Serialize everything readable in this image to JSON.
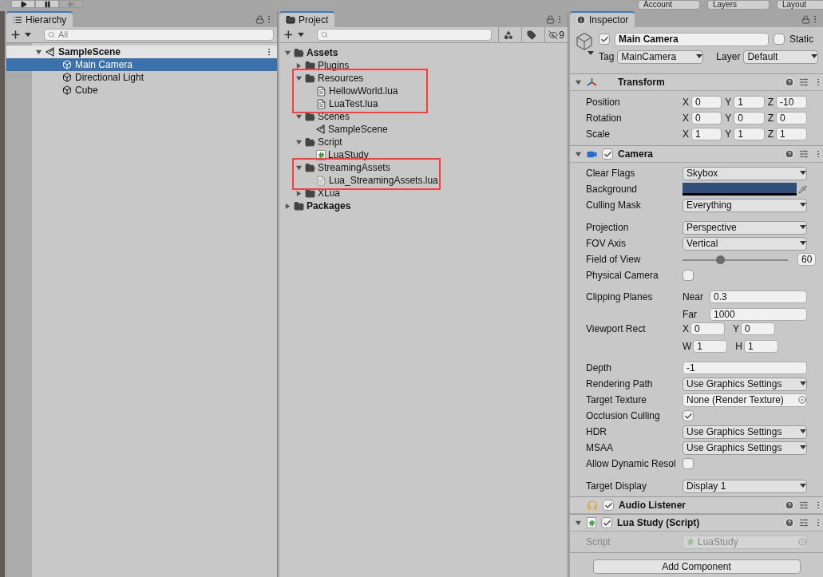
{
  "toolbar": {
    "play_buttons": [
      {
        "kind": "play",
        "disabled": false
      },
      {
        "kind": "pause",
        "disabled": false
      },
      {
        "kind": "step",
        "disabled": true
      }
    ],
    "dropdowns": [
      "Account",
      "Layers",
      "Layout"
    ]
  },
  "hierarchy": {
    "title": "Hierarchy",
    "search": {
      "placeholder": "All"
    },
    "scene": {
      "name": "SampleScene",
      "expanded": true
    },
    "objects": [
      {
        "name": "Main Camera",
        "selected": true
      },
      {
        "name": "Directional Light",
        "selected": false
      },
      {
        "name": "Cube",
        "selected": false
      }
    ]
  },
  "project": {
    "title": "Project",
    "hidden_count": "9",
    "tree": [
      {
        "name": "Assets",
        "kind": "folder",
        "bold": true,
        "expanded": true,
        "highlighted": false,
        "children": [
          {
            "name": "Plugins",
            "kind": "folder",
            "bold": false,
            "expanded": false,
            "highlighted": false
          },
          {
            "name": "Resources",
            "kind": "folder",
            "bold": false,
            "expanded": true,
            "highlighted": true,
            "children": [
              {
                "name": "HellowWorld.lua",
                "kind": "text",
                "bold": false,
                "highlighted": false
              },
              {
                "name": "LuaTest.lua",
                "kind": "text",
                "bold": false,
                "highlighted": false
              }
            ]
          },
          {
            "name": "Scenes",
            "kind": "folder",
            "bold": false,
            "expanded": true,
            "highlighted": false,
            "children": [
              {
                "name": "SampleScene",
                "kind": "scene",
                "bold": false,
                "highlighted": false
              }
            ]
          },
          {
            "name": "Script",
            "kind": "folder",
            "bold": false,
            "expanded": true,
            "highlighted": false,
            "children": [
              {
                "name": "LuaStudy",
                "kind": "script",
                "bold": false,
                "highlighted": false
              }
            ]
          },
          {
            "name": "StreamingAssets",
            "kind": "folder",
            "bold": false,
            "expanded": true,
            "highlighted": true,
            "children": [
              {
                "name": "Lua_StreamingAssets.lua",
                "kind": "lined",
                "bold": false,
                "highlighted": false
              }
            ]
          },
          {
            "name": "XLua",
            "kind": "folder",
            "bold": false,
            "expanded": false,
            "highlighted": false
          }
        ]
      },
      {
        "name": "Packages",
        "kind": "folder",
        "bold": true,
        "expanded": false,
        "highlighted": false
      }
    ]
  },
  "inspector": {
    "title": "Inspector",
    "object": {
      "active": true,
      "name": "Main Camera",
      "static_label": "Static",
      "static": false,
      "tag_label": "Tag",
      "tag": "MainCamera",
      "layer_label": "Layer",
      "layer": "Default"
    },
    "components": [
      {
        "kind": "transform",
        "title": "Transform",
        "expanded": true,
        "rows": [
          {
            "label": "Position",
            "values": [
              {
                "axis": "X",
                "value": "0"
              },
              {
                "axis": "Y",
                "value": "1"
              },
              {
                "axis": "Z",
                "value": "-10"
              }
            ]
          },
          {
            "label": "Rotation",
            "values": [
              {
                "axis": "X",
                "value": "0"
              },
              {
                "axis": "Y",
                "value": "0"
              },
              {
                "axis": "Z",
                "value": "0"
              }
            ]
          },
          {
            "label": "Scale",
            "values": [
              {
                "axis": "X",
                "value": "1"
              },
              {
                "axis": "Y",
                "value": "1"
              },
              {
                "axis": "Z",
                "value": "1"
              }
            ]
          }
        ]
      },
      {
        "kind": "camera",
        "title": "Camera",
        "expanded": true,
        "enabled": true,
        "groups": [
          [
            {
              "kind": "dropdown",
              "label": "Clear Flags",
              "value": "Skybox"
            },
            {
              "kind": "color",
              "label": "Background",
              "color": "#314d79"
            },
            {
              "kind": "dropdown",
              "label": "Culling Mask",
              "value": "Everything"
            }
          ],
          [
            {
              "kind": "dropdown",
              "label": "Projection",
              "value": "Perspective"
            },
            {
              "kind": "dropdown",
              "label": "FOV Axis",
              "value": "Vertical"
            },
            {
              "kind": "slider",
              "label": "Field of View",
              "level": 0.35,
              "value": "60"
            },
            {
              "kind": "checkbox",
              "label": "Physical Camera",
              "checked": false
            }
          ],
          [
            {
              "kind": "pairs",
              "label": "Clipping Planes",
              "fields": [
                [
                  {
                    "axis": "Near",
                    "value": "0.3"
                  }
                ],
                [
                  {
                    "axis": "Far",
                    "value": "1000"
                  }
                ]
              ]
            },
            {
              "kind": "rect",
              "label": "Viewport Rect",
              "fields": [
                [
                  {
                    "axis": "X",
                    "value": "0"
                  },
                  {
                    "axis": "Y",
                    "value": "0"
                  }
                ],
                [
                  {
                    "axis": "W",
                    "value": "1"
                  },
                  {
                    "axis": "H",
                    "value": "1"
                  }
                ]
              ]
            }
          ],
          [
            {
              "kind": "text",
              "label": "Depth",
              "value": "-1"
            },
            {
              "kind": "dropdown",
              "label": "Rendering Path",
              "value": "Use Graphics Settings"
            },
            {
              "kind": "object",
              "label": "Target Texture",
              "value": "None (Render Texture)"
            },
            {
              "kind": "checkbox",
              "label": "Occlusion Culling",
              "checked": true
            },
            {
              "kind": "dropdown",
              "label": "HDR",
              "value": "Use Graphics Settings"
            },
            {
              "kind": "dropdown",
              "label": "MSAA",
              "value": "Use Graphics Settings"
            },
            {
              "kind": "checkbox",
              "label": "Allow Dynamic Resol",
              "checked": false
            }
          ],
          [
            {
              "kind": "dropdown",
              "label": "Target Display",
              "value": "Display 1"
            }
          ]
        ]
      },
      {
        "kind": "audio",
        "title": "Audio Listener",
        "enabled": true
      },
      {
        "kind": "script",
        "title": "Lua Study (Script)",
        "expanded": true,
        "enabled": true,
        "groups": [
          [
            {
              "kind": "script_ref",
              "label": "Script",
              "value": "LuaStudy",
              "disabled": true
            }
          ]
        ]
      }
    ],
    "add_button": "Add Component"
  }
}
